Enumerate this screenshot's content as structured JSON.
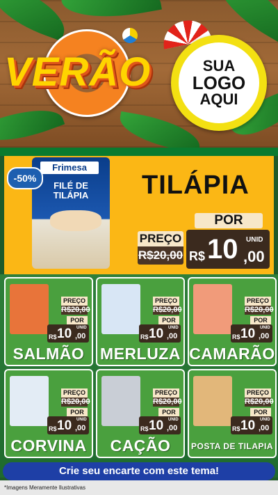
{
  "header": {
    "title": "VERÃO",
    "logo_lines": [
      "SUA",
      "LOGO",
      "AQUI"
    ]
  },
  "feature": {
    "discount_badge": "-50%",
    "package_brand": "Frimesa",
    "package_title": "FILÉ DE TILÁPIA",
    "product_name": "TILÁPIA",
    "preco_label": "PREÇO",
    "old_price": "R$20,00",
    "por_label": "POR",
    "currency": "R$",
    "new_price_int": "10",
    "new_price_dec": ",00",
    "unit": "UNID"
  },
  "products": [
    {
      "name": "SALMÃO",
      "preco_label": "PREÇO",
      "old_price": "R$20,00",
      "por_label": "POR",
      "currency": "R$",
      "price_int": "10",
      "price_dec": ",00",
      "unit": "UNID",
      "img_color": "#e8743a"
    },
    {
      "name": "MERLUZA",
      "preco_label": "PREÇO",
      "old_price": "R$20,00",
      "por_label": "POR",
      "currency": "R$",
      "price_int": "10",
      "price_dec": ",00",
      "unit": "UNID",
      "img_color": "#d8e6f5"
    },
    {
      "name": "CAMARÃO",
      "preco_label": "PREÇO",
      "old_price": "R$20,00",
      "por_label": "POR",
      "currency": "R$",
      "price_int": "10",
      "price_dec": ",00",
      "unit": "UNID",
      "img_color": "#f19b7a"
    },
    {
      "name": "CORVINA",
      "preco_label": "PREÇO",
      "old_price": "R$20,00",
      "por_label": "POR",
      "currency": "R$",
      "price_int": "10",
      "price_dec": ",00",
      "unit": "UNID",
      "img_color": "#e3ecf5"
    },
    {
      "name": "CAÇÃO",
      "preco_label": "PREÇO",
      "old_price": "R$20,00",
      "por_label": "POR",
      "currency": "R$",
      "price_int": "10",
      "price_dec": ",00",
      "unit": "UNID",
      "img_color": "#c9ced6"
    },
    {
      "name": "POSTA DE TILAPIA",
      "preco_label": "PREÇO",
      "old_price": "R$20,00",
      "por_label": "POR",
      "currency": "R$",
      "price_int": "10",
      "price_dec": ",00",
      "unit": "UNID",
      "img_color": "#e2b77a"
    }
  ],
  "cta": "Crie seu encarte com este tema!",
  "disclaimer": "*Imagens Meramente Ilustrativas",
  "colors": {
    "accent_yellow": "#fbb715",
    "green": "#4aa03e",
    "price_dark": "#3b2a1e",
    "cta_blue": "#1e3fa6"
  }
}
